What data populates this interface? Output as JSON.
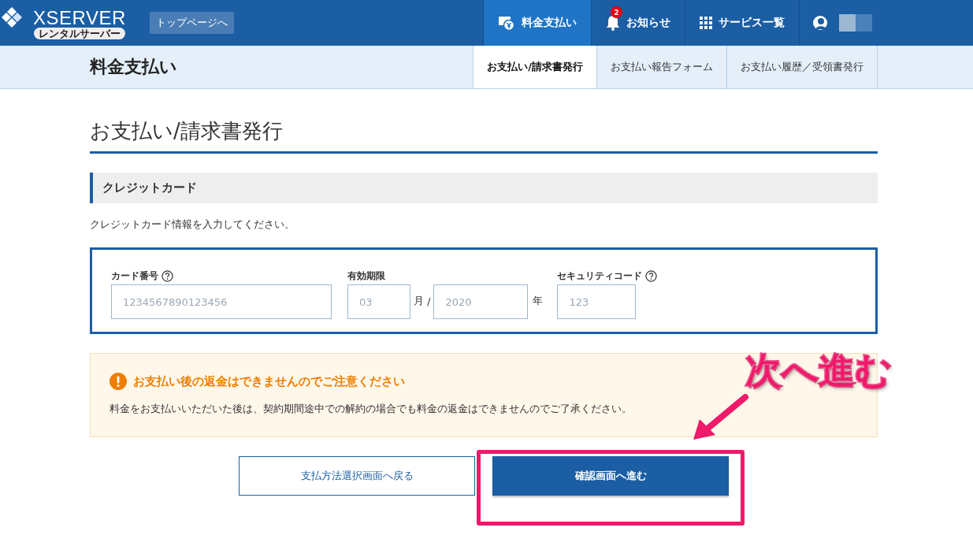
{
  "header": {
    "logo": "XSERVER",
    "logo_badge": "レンタルサーバー",
    "top_link": "トップページへ",
    "nav": [
      {
        "label": "料金支払い",
        "selected": true
      },
      {
        "label": "お知らせ",
        "selected": false,
        "badge": "2"
      },
      {
        "label": "サービス一覧",
        "selected": false
      }
    ]
  },
  "subheader": {
    "title": "料金支払い",
    "tabs": [
      {
        "label": "お支払い/請求書発行",
        "selected": true
      },
      {
        "label": "お支払い報告フォーム",
        "selected": false
      },
      {
        "label": "お支払い履歴／受領書発行",
        "selected": false
      }
    ]
  },
  "page_title": "お支払い/請求書発行",
  "section_title": "クレジットカード",
  "instructions": "クレジットカード情報を入力してください。",
  "card_form": {
    "card_number": {
      "label": "カード番号",
      "placeholder": "1234567890123456"
    },
    "expiry": {
      "label": "有効期限",
      "month_placeholder": "03",
      "month_unit": "月",
      "separator": "/",
      "year_placeholder": "2020",
      "year_unit": "年"
    },
    "security_code": {
      "label": "セキュリティコード",
      "placeholder": "123"
    }
  },
  "notice": {
    "title": "お支払い後の返金はできませんのでご注意ください",
    "body": "料金をお支払いいただいた後は、契約期間途中での解約の場合でも料金の返金はできませんのでご了承ください。"
  },
  "buttons": {
    "back": "支払方法選択画面へ戻る",
    "next": "確認画面へ進む"
  },
  "annotation": {
    "text": "次へ進む"
  }
}
